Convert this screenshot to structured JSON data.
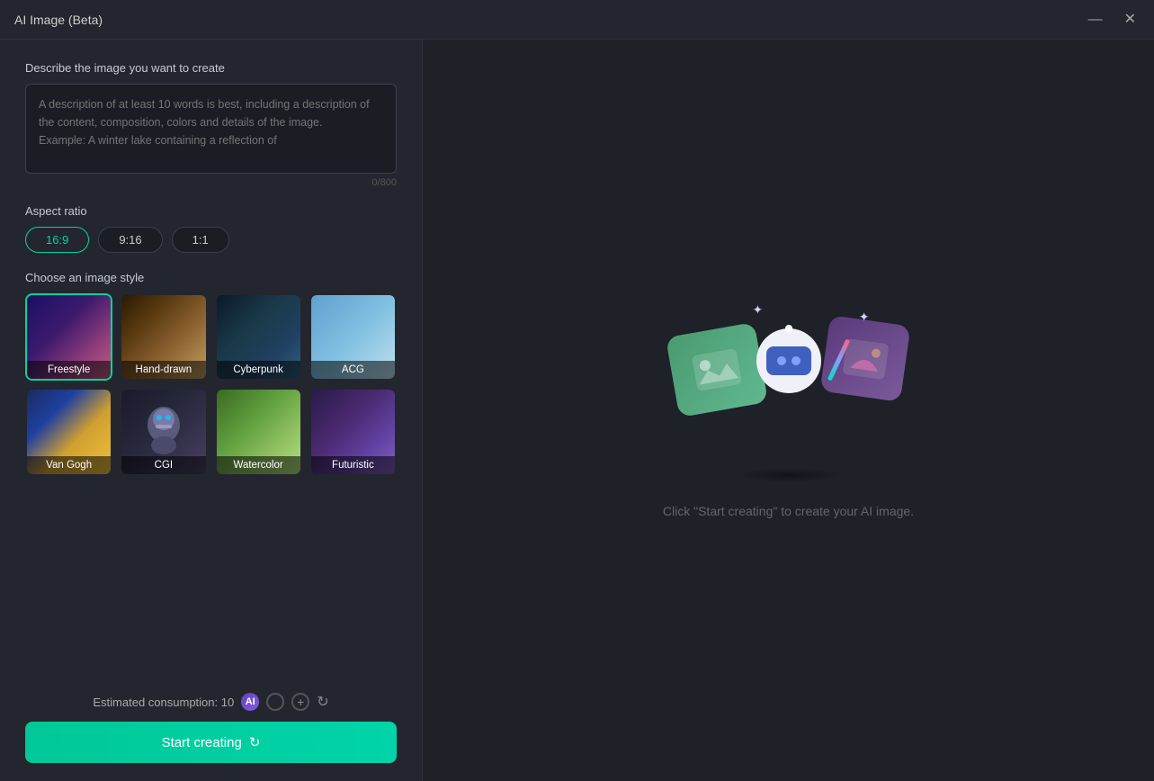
{
  "window": {
    "title": "AI Image (Beta)"
  },
  "titlebar": {
    "minimize_label": "—",
    "close_label": "✕"
  },
  "left": {
    "describe_label": "Describe the image you want to create",
    "textarea_placeholder": "A description of at least 10 words is best, including a description of the content, composition, colors and details of the image.\nExample: A winter lake containing a reflection of",
    "char_count": "0/800",
    "aspect_ratio_label": "Aspect ratio",
    "aspect_options": [
      {
        "id": "16_9",
        "label": "16:9",
        "active": true
      },
      {
        "id": "9_16",
        "label": "9:16",
        "active": false
      },
      {
        "id": "1_1",
        "label": "1:1",
        "active": false
      }
    ],
    "style_label": "Choose an image style",
    "styles": [
      {
        "id": "freestyle",
        "label": "Freestyle",
        "selected": true,
        "css_class": "style-freestyle"
      },
      {
        "id": "handdrawn",
        "label": "Hand-drawn",
        "selected": false,
        "css_class": "style-handdrawn"
      },
      {
        "id": "cyberpunk",
        "label": "Cyberpunk",
        "selected": false,
        "css_class": "style-cyberpunk"
      },
      {
        "id": "acg",
        "label": "ACG",
        "selected": false,
        "css_class": "style-acg"
      },
      {
        "id": "vangogh",
        "label": "Van Gogh",
        "selected": false,
        "css_class": "style-vangogh"
      },
      {
        "id": "cgi",
        "label": "CGI",
        "selected": false,
        "css_class": "style-cgi"
      },
      {
        "id": "watercolor",
        "label": "Watercolor",
        "selected": false,
        "css_class": "style-watercolor"
      },
      {
        "id": "futuristic",
        "label": "Futuristic",
        "selected": false,
        "css_class": "style-futuristic"
      }
    ],
    "consumption_label": "Estimated consumption: 10",
    "start_btn_label": "Start creating"
  },
  "right": {
    "placeholder_text": "Click \"Start creating\" to create your AI image."
  }
}
